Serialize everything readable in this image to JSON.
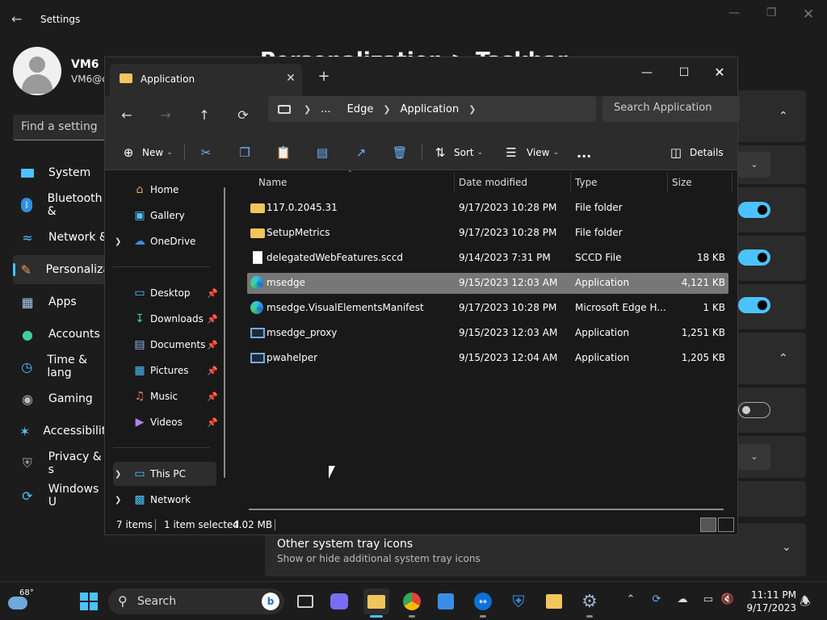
{
  "settings": {
    "title": "Settings",
    "user_name": "VM6",
    "user_email": "VM6@c",
    "search_placeholder": "Find a setting",
    "heading": "Personalization > Taskbar",
    "nav": [
      "System",
      "Bluetooth &",
      "Network &",
      "Personaliza",
      "Apps",
      "Accounts",
      "Time & lang",
      "Gaming",
      "Accessibility",
      "Privacy & s",
      "Windows U"
    ],
    "tray_title": "Other system tray icons",
    "tray_desc": "Show or hide additional system tray icons"
  },
  "explorer": {
    "tab_title": "Application",
    "breadcrumb": [
      "...",
      "Edge",
      "Application"
    ],
    "search_placeholder": "Search Application",
    "toolbar": {
      "new_label": "New",
      "sort_label": "Sort",
      "view_label": "View",
      "more_label": "...",
      "details_label": "Details"
    },
    "sidebar": {
      "home": "Home",
      "gallery": "Gallery",
      "onedrive": "OneDrive",
      "desktop": "Desktop",
      "downloads": "Downloads",
      "documents": "Documents",
      "pictures": "Pictures",
      "music": "Music",
      "videos": "Videos",
      "thispc": "This PC",
      "network": "Network"
    },
    "columns": [
      "Name",
      "Date modified",
      "Type",
      "Size"
    ],
    "files": [
      {
        "name": "117.0.2045.31",
        "date": "9/17/2023 10:28 PM",
        "type": "File folder",
        "size": "",
        "icon": "folder"
      },
      {
        "name": "SetupMetrics",
        "date": "9/17/2023 10:28 PM",
        "type": "File folder",
        "size": "",
        "icon": "folder"
      },
      {
        "name": "delegatedWebFeatures.sccd",
        "date": "9/14/2023 7:31 PM",
        "type": "SCCD File",
        "size": "18 KB",
        "icon": "document"
      },
      {
        "name": "msedge",
        "date": "9/15/2023 12:03 AM",
        "type": "Application",
        "size": "4,121 KB",
        "icon": "edge"
      },
      {
        "name": "msedge.VisualElementsManifest",
        "date": "9/17/2023 10:28 PM",
        "type": "Microsoft Edge H...",
        "size": "1 KB",
        "icon": "edge"
      },
      {
        "name": "msedge_proxy",
        "date": "9/15/2023 12:03 AM",
        "type": "Application",
        "size": "1,251 KB",
        "icon": "application"
      },
      {
        "name": "pwahelper",
        "date": "9/15/2023 12:04 AM",
        "type": "Application",
        "size": "1,205 KB",
        "icon": "application"
      }
    ],
    "status": {
      "count": "7 items",
      "selection": "1 item selected",
      "size": "4.02 MB"
    }
  },
  "taskbar": {
    "weather_temp": "68°",
    "search_label": "Search",
    "time": "11:11 PM",
    "date": "9/17/2023"
  },
  "colors": {
    "accent": "#4cc2ff",
    "folder": "#f2c55c",
    "selection": "#777777"
  }
}
